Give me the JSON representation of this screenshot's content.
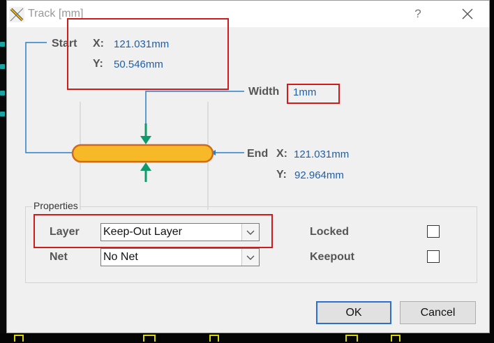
{
  "window": {
    "title": "Track [mm]",
    "help": "?",
    "close": "✕"
  },
  "start": {
    "label": "Start",
    "x_label": "X:",
    "x_value": "121.031mm",
    "y_label": "Y:",
    "y_value": "50.546mm"
  },
  "width": {
    "label": "Width",
    "value": "1mm"
  },
  "end": {
    "label": "End",
    "x_label": "X:",
    "x_value": "121.031mm",
    "y_label": "Y:",
    "y_value": "92.964mm"
  },
  "properties": {
    "title": "Properties",
    "layer_label": "Layer",
    "layer_value": "Keep-Out Layer",
    "net_label": "Net",
    "net_value": "No Net",
    "locked_label": "Locked",
    "keepout_label": "Keepout",
    "locked_checked": false,
    "keepout_checked": false
  },
  "buttons": {
    "ok": "OK",
    "cancel": "Cancel"
  },
  "colors": {
    "accent": "#2a6fd1",
    "value_text": "#1f5fa8",
    "track_fill": "#f7b928",
    "track_outline": "#d06a1a",
    "arrow_green": "#0f9a6a",
    "annotation_red": "#d11a1a"
  }
}
